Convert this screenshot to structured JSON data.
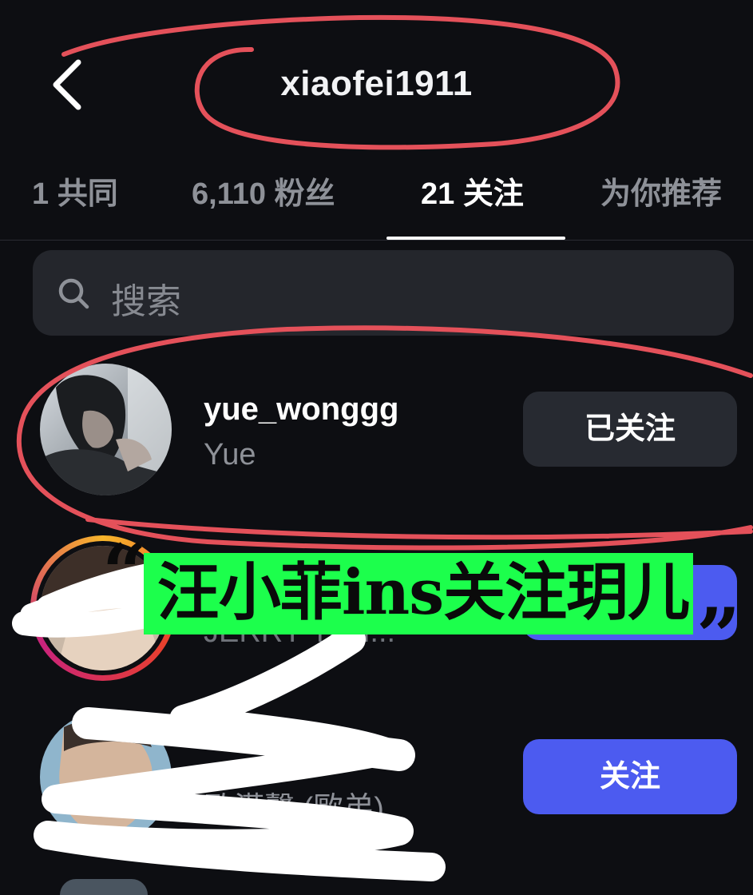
{
  "header": {
    "title": "xiaofei1911",
    "back_icon": "chevron-left-icon"
  },
  "tabs": [
    {
      "label": "1 共同",
      "active": false
    },
    {
      "label": "6,110 粉丝",
      "active": false
    },
    {
      "label": "21 关注",
      "active": true
    },
    {
      "label": "为你推荐",
      "active": false
    }
  ],
  "search": {
    "placeholder": "搜索",
    "icon": "search-icon"
  },
  "rows": [
    {
      "username": "yue_wonggg",
      "display_name": "Yue",
      "button": "已关注",
      "button_state": "following"
    },
    {
      "username": "",
      "display_name": "JERRY YAN...",
      "button": "",
      "button_state": "follow"
    },
    {
      "username": "",
      "display_name": "歐漢聲 (歐弟)",
      "button": "关注",
      "button_state": "follow"
    }
  ],
  "annotation": {
    "caption": "汪小菲ins关注玥儿",
    "open_quote": "“",
    "close_quote": "”",
    "highlight_color": "#1cff4c",
    "circle_color": "#e4515a"
  },
  "colors": {
    "background": "#0d0e12",
    "follow_button": "#4c5bf0",
    "following_button": "#272a31"
  }
}
